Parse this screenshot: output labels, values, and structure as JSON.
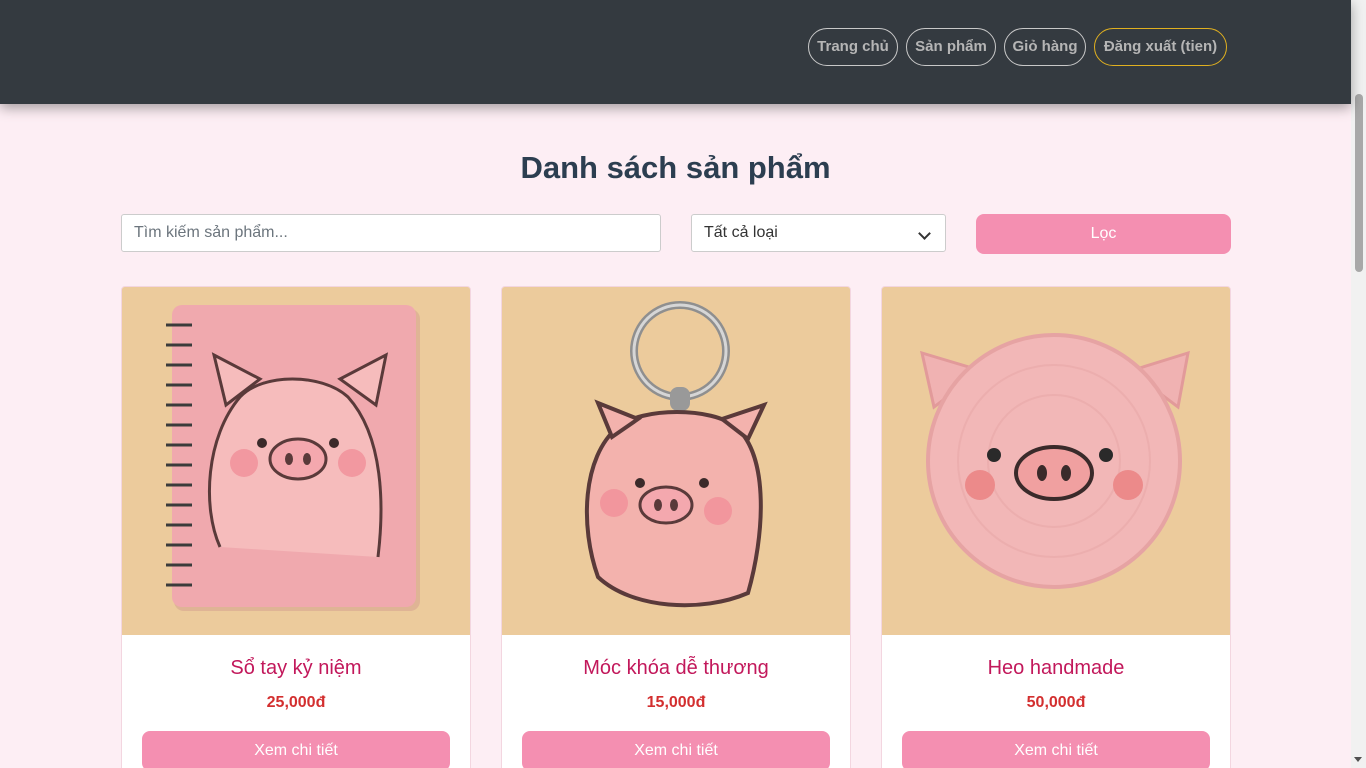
{
  "nav": {
    "home": "Trang chủ",
    "products": "Sản phẩm",
    "cart": "Giỏ hàng",
    "logout": "Đăng xuất (tien)"
  },
  "page_title": "Danh sách sản phẩm",
  "search": {
    "placeholder": "Tìm kiếm sản phẩm...",
    "value": ""
  },
  "category": {
    "selected": "Tất cả loại"
  },
  "filter_label": "Lọc",
  "products": [
    {
      "name": "Sổ tay kỷ niệm",
      "price": "25,000đ",
      "button": "Xem chi tiết",
      "image": "pig-notebook"
    },
    {
      "name": "Móc khóa dễ thương",
      "price": "15,000đ",
      "button": "Xem chi tiết",
      "image": "pig-keychain"
    },
    {
      "name": "Heo handmade",
      "price": "50,000đ",
      "button": "Xem chi tiết",
      "image": "pig-crochet-coaster"
    }
  ],
  "colors": {
    "navbar": "#343a40",
    "page_background": "#fdeef4",
    "accent_button": "#f48fb1",
    "product_title": "#c2185b",
    "price": "#d32f2f",
    "logout_border": "#e0b020"
  }
}
